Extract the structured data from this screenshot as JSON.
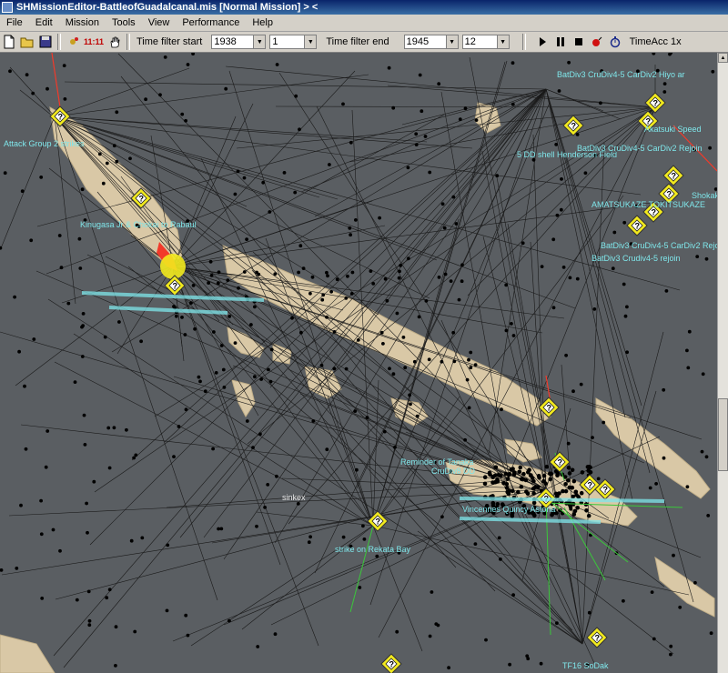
{
  "window": {
    "title": "SHMissionEditor-BattleofGuadalcanal.mis [Normal Mission]  > <"
  },
  "menu": [
    "File",
    "Edit",
    "Mission",
    "Tools",
    "View",
    "Performance",
    "Help"
  ],
  "toolbar": {
    "clock_label": "11:11",
    "filter_start_label": "Time filter start",
    "filter_start_year": "1938",
    "filter_start_month": "1",
    "filter_end_label": "Time filter end",
    "filter_end_year": "1945",
    "filter_end_month": "12",
    "time_acc": "TimeAcc 1x"
  },
  "map": {
    "labels": [
      "BatDiv3 CruDiv4-5 CarDiv2 Hiyo ar",
      "Attack Group 2 strikes",
      "Akatsuki Speed",
      "BatDiv3 CruDiv4-5 CarDiv2 Rejoin",
      "5 DD shell Henderson Field",
      "Kinugasa Jr & Chokai to Rabaul",
      "AMATSUKAZE TOKITSUKAZE",
      "Shokak",
      "BatDiv3 CruDiv4-5 CarDiv2 Rejoin",
      "BatDiv3 Crudiv4-5 rejoin",
      "Reminder of Tanaka",
      "CruDiv8 DD",
      "sinkex",
      "strike on Rekata Bay",
      "Vincennes Quincy Astoria",
      "TF16 SoDak"
    ],
    "colors": {
      "sea": "#5a5e62",
      "land": "#d9c8a6",
      "route": "#1a1a1a",
      "label": "#7fe6ea",
      "waypoint": "#f2ea1e",
      "highlight": "#f23a2a",
      "green_line": "#3ac83a"
    },
    "icons": [
      "unit-marker-icon",
      "waypoint-icon"
    ]
  }
}
